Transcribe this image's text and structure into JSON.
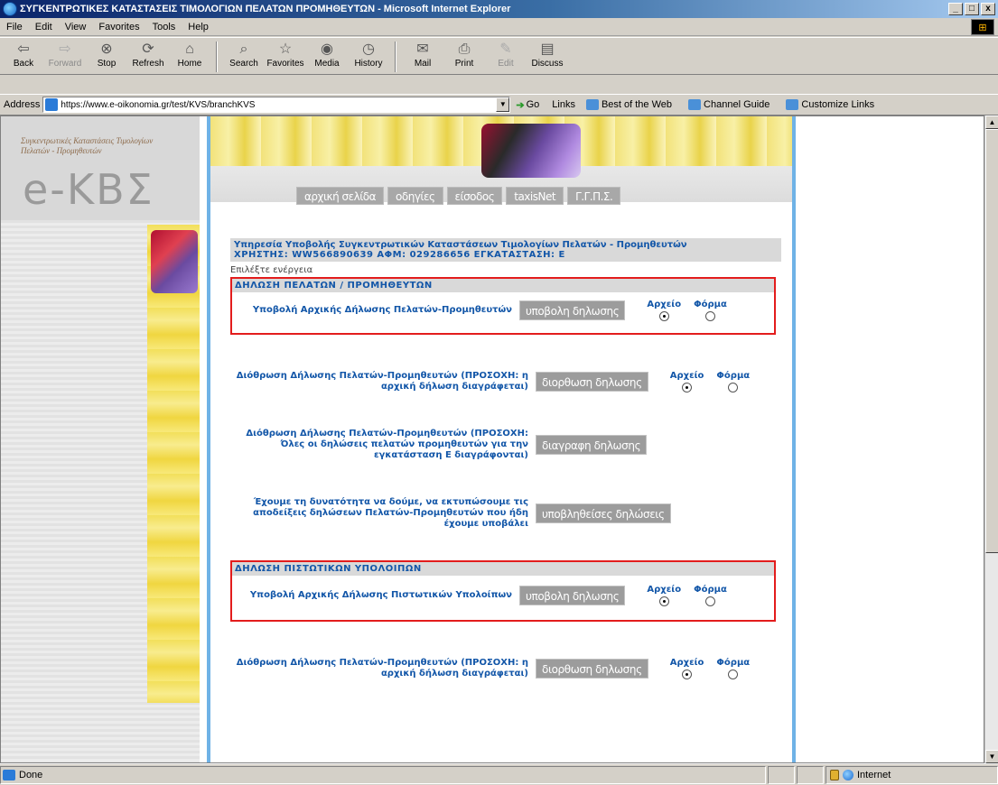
{
  "window": {
    "title": "ΣΥΓΚΕΝΤΡΩΤΙΚΕΣ ΚΑΤΑΣΤΑΣΕΙΣ ΤΙΜΟΛΟΓΙΩΝ ΠΕΛΑΤΩΝ ΠΡΟΜΗΘΕΥΤΩΝ - Microsoft Internet Explorer",
    "minimize": "_",
    "maximize": "□",
    "close": "x"
  },
  "menu": [
    "File",
    "Edit",
    "View",
    "Favorites",
    "Tools",
    "Help"
  ],
  "toolbar": {
    "back": "Back",
    "forward": "Forward",
    "stop": "Stop",
    "refresh": "Refresh",
    "home": "Home",
    "search": "Search",
    "favorites": "Favorites",
    "media": "Media",
    "history": "History",
    "mail": "Mail",
    "print": "Print",
    "edit": "Edit",
    "discuss": "Discuss"
  },
  "address": {
    "label": "Address",
    "url": "https://www.e-oikonomia.gr/test/KVS/branchKVS",
    "go": "Go",
    "links_label": "Links",
    "links": [
      "Best of the Web",
      "Channel Guide",
      "Customize Links"
    ]
  },
  "logo": {
    "subtitle": "Συγκεντρωτικές Καταστάσεις Τιμολογίων Πελατών - Προμηθευτών",
    "main": "e-ΚΒΣ"
  },
  "nav": [
    "αρχική σελίδα",
    "οδηγίες",
    "είσοδος",
    "taxisNet",
    "Γ.Γ.Π.Σ."
  ],
  "service": {
    "title": "Υπηρεσία Υποβολής Συγκεντρωτικών Καταστάσεων Τιμολογίων Πελατών - Προμηθευτών",
    "user_line": "ΧΡΗΣΤΗΣ: WW566890639 ΑΦΜ: 029286656 ΕΓΚΑΤΑΣΤΑΣΗ: Ε",
    "choose_action": "Επιλέξτε ενέργεια"
  },
  "format_labels": {
    "file": "Αρχείο",
    "form": "Φόρμα"
  },
  "section1": {
    "header": "ΔΗΛΩΣΗ ΠΕΛΑΤΩΝ / ΠΡΟΜΗΘΕΥΤΩΝ",
    "rows": [
      {
        "text": "Υποβολή Αρχικής Δήλωσης Πελατών-Προμηθευτών",
        "button": "υποβολη δηλωσης",
        "has_format": true,
        "selected": "file"
      },
      {
        "text": "Διόθρωση Δήλωσης Πελατών-Προμηθευτών (ΠΡΟΣΟΧΗ: η αρχική δήλωση διαγράφεται)",
        "button": "διορθωση δηλωσης",
        "has_format": true,
        "selected": "file"
      },
      {
        "text": "Διόθρωση Δήλωσης Πελατών-Προμηθευτών (ΠΡΟΣΟΧΗ: Όλες οι δηλώσεις πελατών προμηθευτών για την εγκατάσταση Ε διαγράφονται)",
        "button": "διαγραφη δηλωσης",
        "has_format": false
      },
      {
        "text": "Έχουμε τη δυνατότητα να δούμε, να εκτυπώσουμε τις αποδείξεις δηλώσεων Πελατών-Προμηθευτών που ήδη έχουμε υποβάλει",
        "button": "υποβληθείσες δηλώσεις",
        "has_format": false
      }
    ]
  },
  "section2": {
    "header": "ΔΗΛΩΣΗ ΠΙΣΤΩΤΙΚΩΝ ΥΠΟΛΟΙΠΩΝ",
    "rows": [
      {
        "text": "Υποβολή Αρχικής Δήλωσης Πιστωτικών Υπολοίπων",
        "button": "υποβολη δηλωσης",
        "has_format": true,
        "selected": "file"
      },
      {
        "text": "Διόθρωση Δήλωσης Πελατών-Προμηθευτών (ΠΡΟΣΟΧΗ: η αρχική δήλωση διαγράφεται)",
        "button": "διορθωση δηλωσης",
        "has_format": true,
        "selected": "file"
      }
    ]
  },
  "status": {
    "text": "Done",
    "zone": "Internet"
  }
}
